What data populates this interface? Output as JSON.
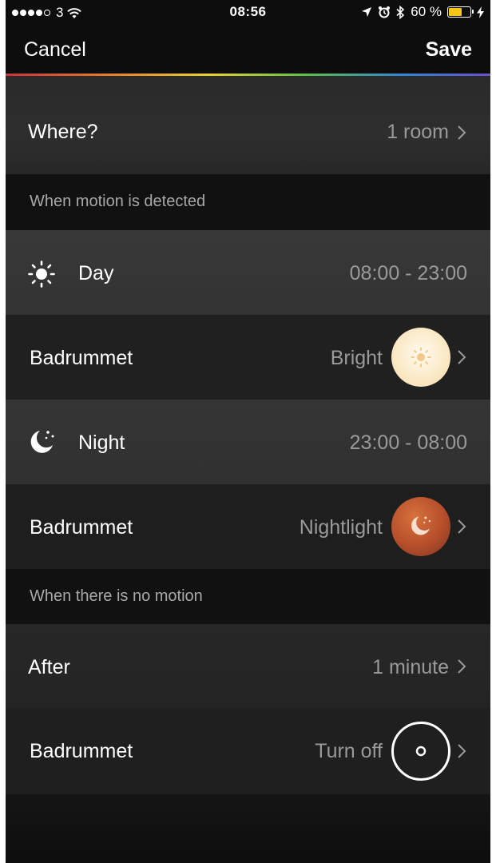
{
  "status_bar": {
    "carrier": "3",
    "time": "08:56",
    "battery_percent": "60 %",
    "battery_level": 0.6,
    "signal_bars_filled": 4,
    "signal_bars_total": 5
  },
  "nav": {
    "cancel_label": "Cancel",
    "save_label": "Save"
  },
  "where": {
    "label": "Where?",
    "value": "1 room"
  },
  "motion_section": {
    "title": "When motion is detected"
  },
  "day": {
    "label": "Day",
    "time_range": "08:00 - 23:00",
    "icon": "sun-icon"
  },
  "day_scene": {
    "room": "Badrummet",
    "scene": "Bright",
    "color": "#fbeac8"
  },
  "night": {
    "label": "Night",
    "time_range": "23:00 - 08:00",
    "icon": "moon-icon"
  },
  "night_scene": {
    "room": "Badrummet",
    "scene": "Nightlight",
    "color": "#b54e2a"
  },
  "no_motion_section": {
    "title": "When there is no motion"
  },
  "after": {
    "label": "After",
    "value": "1 minute"
  },
  "off_scene": {
    "room": "Badrummet",
    "scene": "Turn off"
  },
  "colors": {
    "background": "#1a1a1a",
    "accent_yellow": "#f5c518",
    "text_secondary": "#9a9a9a"
  }
}
